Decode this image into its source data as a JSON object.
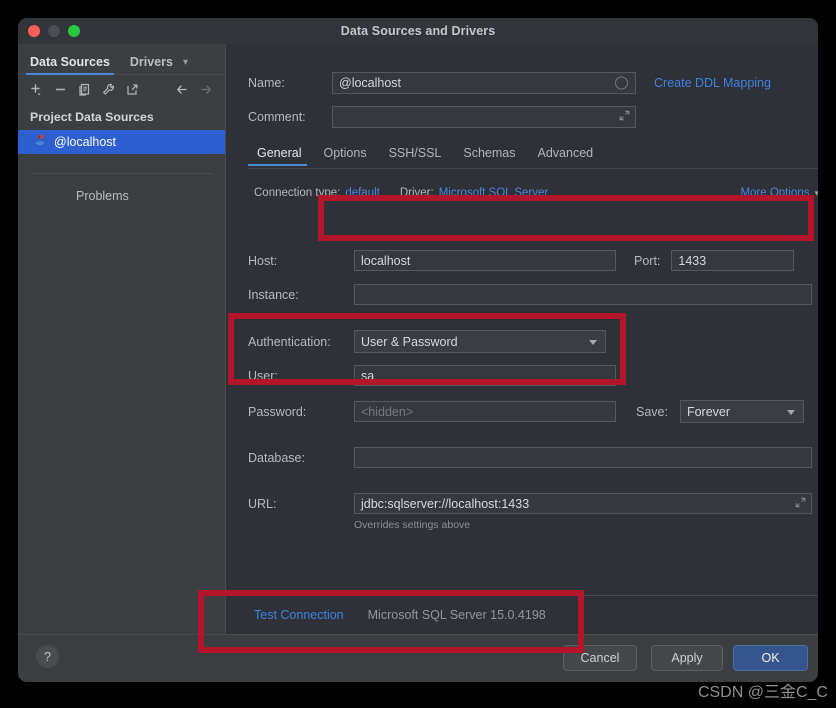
{
  "window": {
    "title": "Data Sources and Drivers",
    "traffic_lights": [
      "close",
      "minimize",
      "zoom"
    ]
  },
  "sidebar": {
    "tabs": [
      {
        "label": "Data Sources",
        "active": true
      },
      {
        "label": "Drivers",
        "active": false
      }
    ],
    "tabs_overflow_icon": "chevron-down-icon",
    "toolbar_icons": [
      "add-icon",
      "remove-icon",
      "copy-icon",
      "wrench-icon",
      "share-icon",
      "back-arrow-icon",
      "forward-arrow-icon"
    ],
    "group_header": "Project Data Sources",
    "selected_item": "@localhost",
    "problems_label": "Problems"
  },
  "form": {
    "name_label": "Name:",
    "name_value": "@localhost",
    "create_ddl_mapping": "Create DDL Mapping",
    "comment_label": "Comment:",
    "comment_value": ""
  },
  "tabs": [
    {
      "label": "General",
      "active": true
    },
    {
      "label": "Options",
      "active": false
    },
    {
      "label": "SSH/SSL",
      "active": false
    },
    {
      "label": "Schemas",
      "active": false
    },
    {
      "label": "Advanced",
      "active": false
    }
  ],
  "connection": {
    "type_label": "Connection type:",
    "type_value": "default",
    "driver_label": "Driver:",
    "driver_value": "Microsoft SQL Server",
    "more_options": "More Options",
    "more_options_icon": "chevron-down-icon",
    "host_label": "Host:",
    "host_value": "localhost",
    "port_label": "Port:",
    "port_value": "1433",
    "instance_label": "Instance:",
    "instance_value": "",
    "authentication_label": "Authentication:",
    "authentication_value": "User & Password",
    "user_label": "User:",
    "user_value": "sa",
    "password_label": "Password:",
    "password_placeholder": "<hidden>",
    "password_value": "",
    "save_label": "Save:",
    "save_value": "Forever",
    "database_label": "Database:",
    "database_value": "",
    "url_label": "URL:",
    "url_value": "jdbc:sqlserver://localhost:1433",
    "url_hint": "Overrides settings above"
  },
  "test_strip": {
    "test_connection": "Test Connection",
    "server_version": "Microsoft SQL Server 15.0.4198"
  },
  "footer": {
    "help": "?",
    "cancel": "Cancel",
    "apply": "Apply",
    "ok": "OK"
  },
  "watermark": "CSDN @三金C_C",
  "colors": {
    "accent_blue": "#4a88d8",
    "link_blue": "#3f82e0",
    "selection_blue": "#2d5fd0",
    "annotation_red": "#b3152b",
    "ok_button": "#35558c"
  }
}
